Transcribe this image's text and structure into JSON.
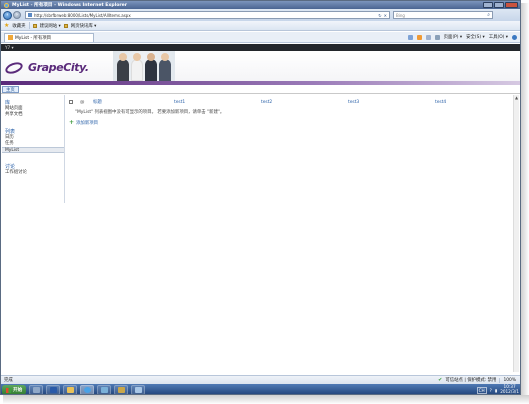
{
  "window": {
    "title": "MyList - 所有项目 - Windows Internet Explorer"
  },
  "addressbar": {
    "url": "http://sbrfbrweb:8000/Lists/MyList/AllItems.aspx",
    "search_placeholder": "Bing",
    "refresh_glyph": "↻",
    "stop_glyph": "✕"
  },
  "favorites": {
    "label": "收藏夹",
    "items": [
      "建议网站 ▾",
      "网页快讯库 ▾"
    ]
  },
  "tabs": {
    "active_label": "MyList - 所有项目",
    "toolbar": [
      "页面(P) ▾",
      "安全(S) ▾",
      "工具(O) ▾"
    ]
  },
  "sharepoint": {
    "site_strip": "Y7 ▾",
    "brand": "GrapeCity.",
    "nav_home": "主页"
  },
  "quicklaunch": {
    "sections": [
      {
        "heading": "库",
        "items": [
          "网站页面",
          "共享文档"
        ]
      },
      {
        "heading": "列表",
        "items": [
          "日历",
          "任务",
          "MyList"
        ]
      },
      {
        "heading": "讨论",
        "items": [
          "工作组讨论"
        ]
      }
    ],
    "selected": "MyList"
  },
  "list": {
    "columns": [
      "标题",
      "test1",
      "test2",
      "test3",
      "test4"
    ],
    "empty_message": "\"MyList\" 列表视图中没有可显示的项目。 若要添加新项目，请单击 \"新建\"。",
    "add_label": "添加新项目"
  },
  "statusbar": {
    "text": "完成",
    "zone": "可信站点 | 保护模式: 禁用",
    "zoom": "100%"
  },
  "taskbar": {
    "start": "开始",
    "lang": "CH",
    "time": "10:37",
    "date": "2012/3/1"
  },
  "colors": {
    "brand_purple": "#5a2a7a",
    "link_blue": "#2c62a9",
    "titlebar_blue": "#4a6592"
  }
}
